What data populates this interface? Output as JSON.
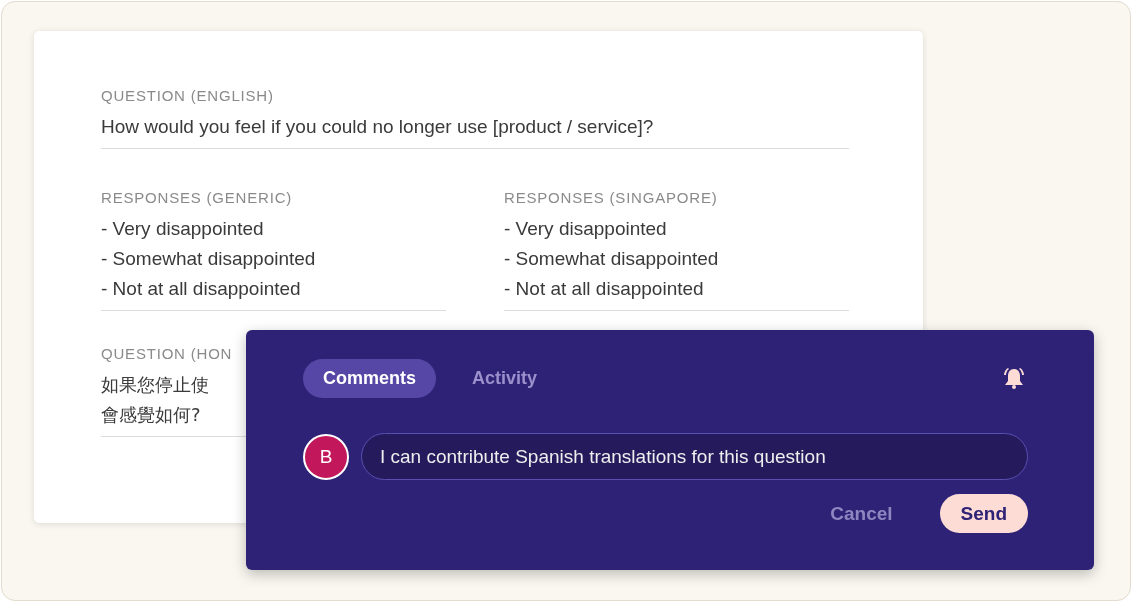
{
  "card": {
    "sections": [
      {
        "kind": "question",
        "label": "QUESTION (ENGLISH)",
        "lines": [
          "How would you feel if you could no longer use [product / service]?"
        ]
      },
      {
        "kind": "responses",
        "columns": [
          {
            "label": "RESPONSES (GENERIC)",
            "lines": [
              "- Very disappointed",
              "- Somewhat disappointed",
              "- Not at all disappointed"
            ]
          },
          {
            "label": "RESPONSES (SINGAPORE)",
            "lines": [
              "- Very disappointed",
              "- Somewhat disappointed",
              "- Not at all disappointed"
            ]
          }
        ]
      },
      {
        "kind": "question",
        "label": "QUESTION (HON",
        "lines": [
          "如果您停止使",
          "會感覺如何?"
        ]
      }
    ]
  },
  "comments_panel": {
    "tabs": [
      {
        "label": "Comments",
        "selected": true
      },
      {
        "label": "Activity",
        "selected": false
      }
    ],
    "avatar": "B",
    "comment": "I can contribute Spanish translations for this question",
    "buttons": [
      {
        "kind": "secondary",
        "label": "Cancel"
      },
      {
        "kind": "primary",
        "label": "Send"
      }
    ]
  }
}
